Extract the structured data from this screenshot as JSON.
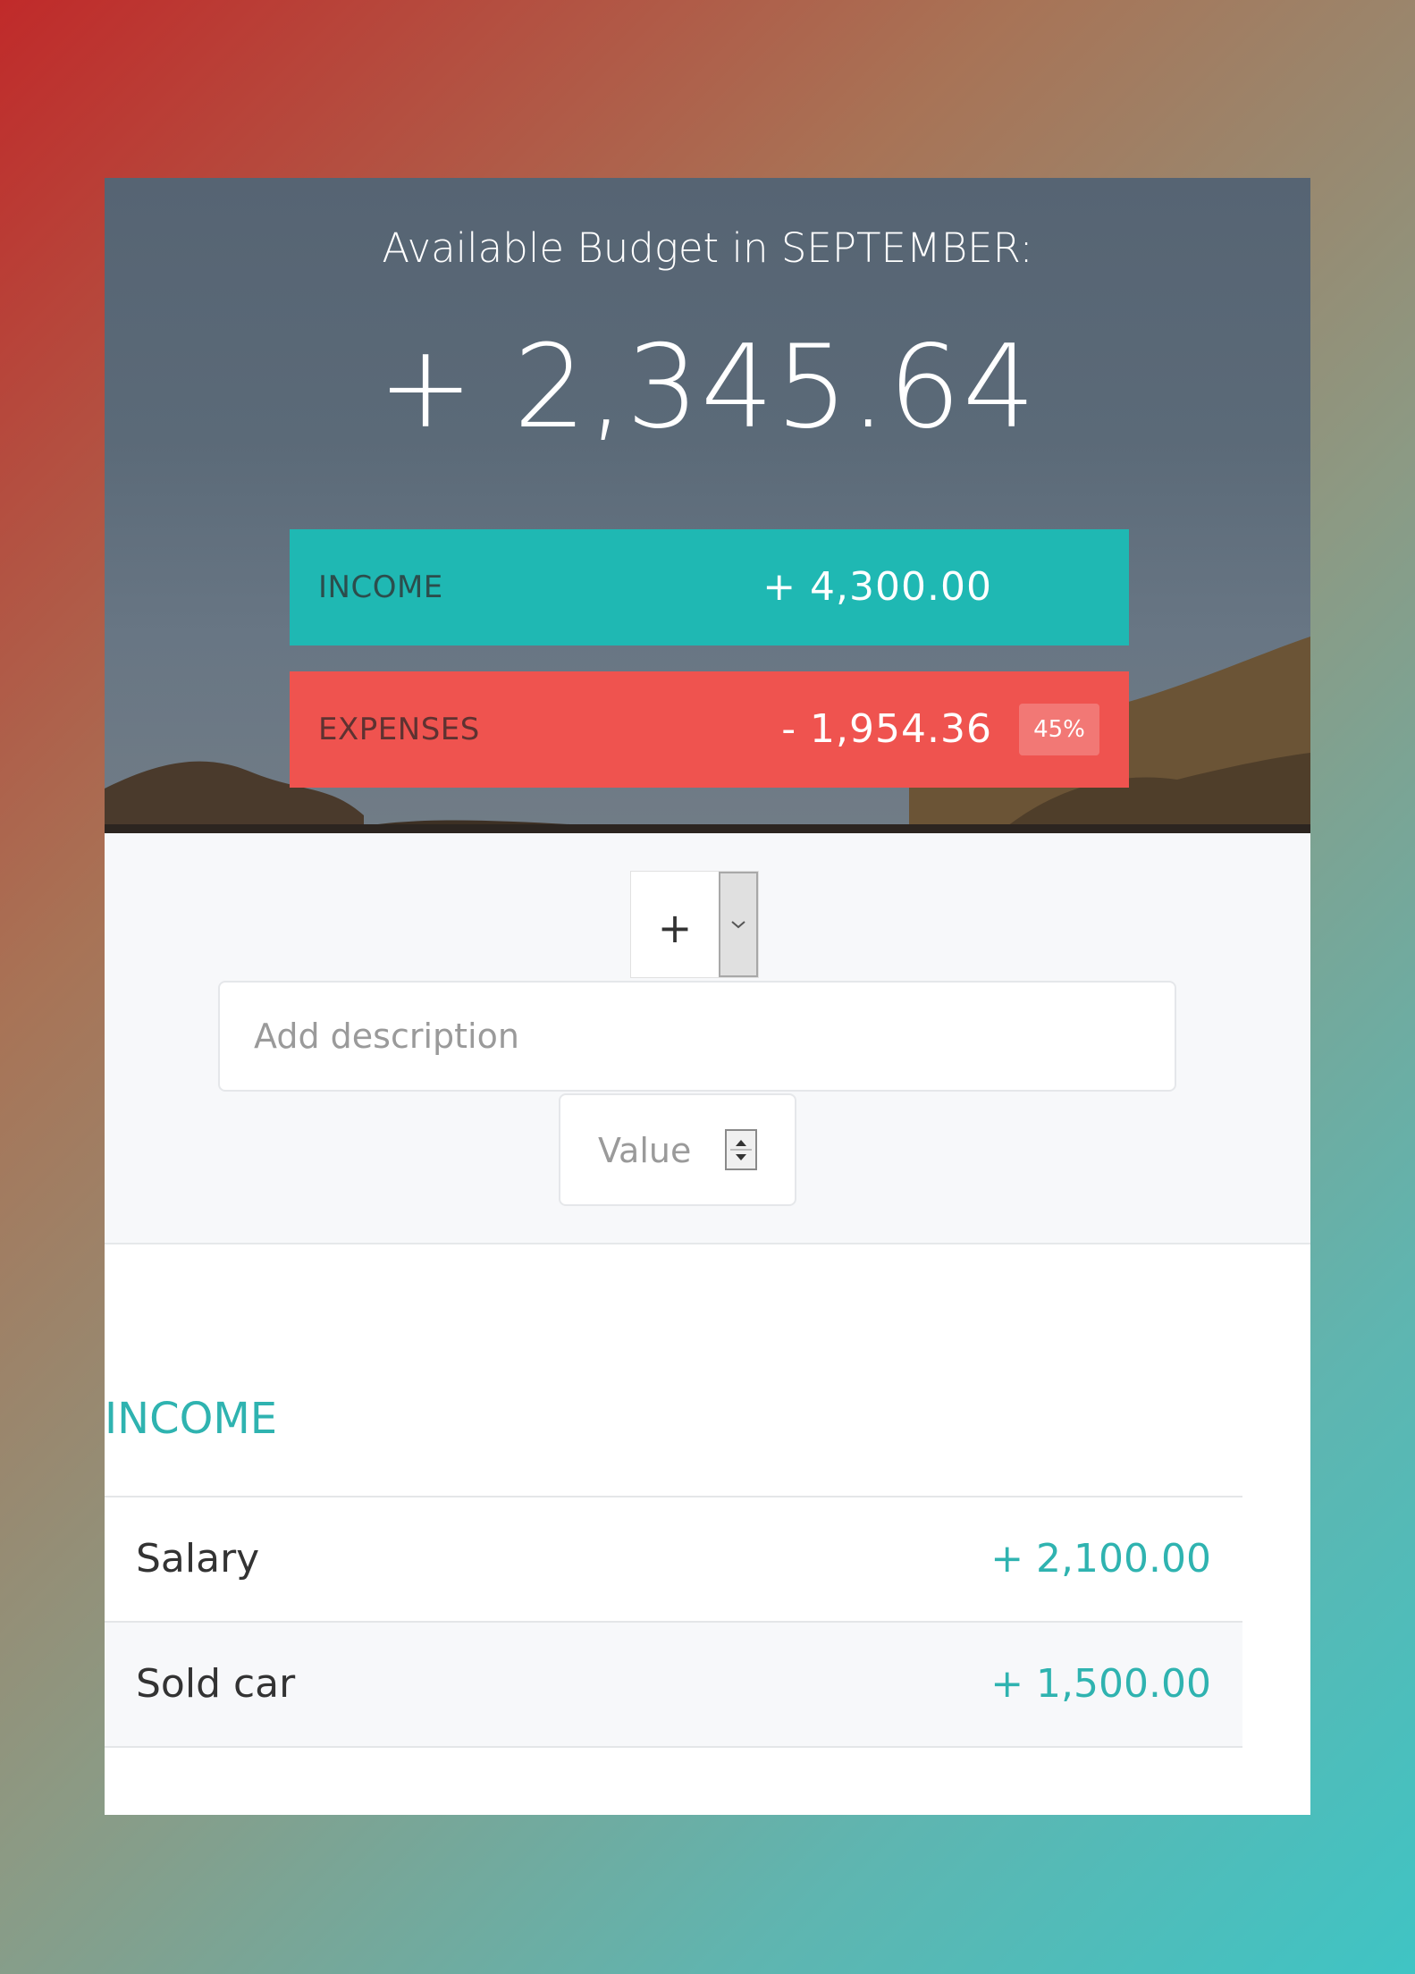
{
  "colors": {
    "income": "#1fb8b3",
    "expenses": "#ef534f",
    "accent_text": "#2fb3b0"
  },
  "header": {
    "title": "Available Budget in SEPTEMBER:",
    "budget_value": "+ 2,345.64"
  },
  "summary": {
    "income": {
      "label": "INCOME",
      "value": "+ 4,300.00"
    },
    "expenses": {
      "label": "EXPENSES",
      "value": "- 1,954.36",
      "percentage": "45%"
    }
  },
  "add_form": {
    "type_select_value": "+",
    "description_placeholder": "Add description",
    "value_placeholder": "Value"
  },
  "income_list": {
    "title": "INCOME",
    "items": [
      {
        "description": "Salary",
        "value": "+ 2,100.00"
      },
      {
        "description": "Sold car",
        "value": "+ 1,500.00"
      }
    ]
  }
}
